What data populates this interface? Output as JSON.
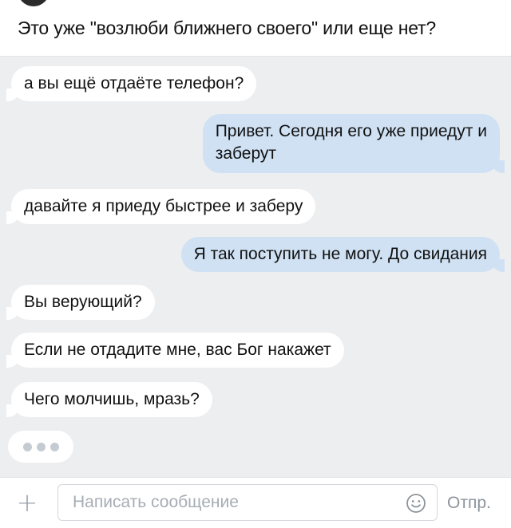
{
  "post": {
    "caption": "Это уже \"возлюби ближнего своего\" или еще нет?"
  },
  "chat": {
    "messages": [
      {
        "direction": "in",
        "text": "а вы ещё отдаёте телефон?"
      },
      {
        "direction": "out",
        "lines": [
          "Привет. Сегодня его уже приедут и",
          "заберут"
        ]
      },
      {
        "direction": "in",
        "text": "давайте я приеду быстрее и заберу"
      },
      {
        "direction": "out",
        "text": "Я так поступить не могу. До свидания"
      },
      {
        "direction": "in",
        "text": "Вы верующий?"
      },
      {
        "direction": "in",
        "text": "Если не отдадите мне, вас Бог накажет"
      },
      {
        "direction": "in",
        "text": "Чего молчишь, мразь?"
      }
    ],
    "typing_indicator": true
  },
  "composer": {
    "attach_icon": "plus-icon",
    "placeholder": "Написать сообщение",
    "emoji_icon": "smile-icon",
    "send_label": "Отпр."
  },
  "colors": {
    "chat_background": "#edeef0",
    "incoming_bubble": "#ffffff",
    "outgoing_bubble": "#cfe1f3"
  }
}
